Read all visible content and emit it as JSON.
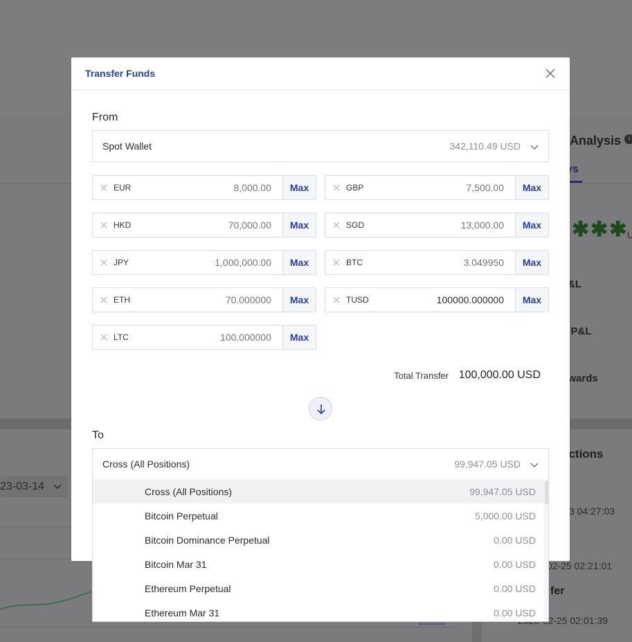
{
  "background": {
    "analysis_title": "Analysis",
    "tab_partial": "ys",
    "masked_value": "✱✱✱",
    "masked_suffix": "U",
    "row1": "&L",
    "row2": "s P&L",
    "row3": "ewards",
    "transactions_title": "actions",
    "date_partial": "23-03-14",
    "tx1_time": "3 04:27:03",
    "tx2_time": "02-25 02:21:01",
    "tx3_label": "fer",
    "tx3_time": "2023-02-25 02:01:39"
  },
  "modal": {
    "title": "Transfer Funds",
    "from_label": "From",
    "from_wallet": {
      "name": "Spot Wallet",
      "balance": "342,110.49 USD"
    },
    "coins": [
      {
        "name": "EUR",
        "value": "",
        "placeholder": "8,000.00",
        "max": "Max"
      },
      {
        "name": "GBP",
        "value": "",
        "placeholder": "7,500.00",
        "max": "Max"
      },
      {
        "name": "HKD",
        "value": "",
        "placeholder": "70,000.00",
        "max": "Max"
      },
      {
        "name": "SGD",
        "value": "",
        "placeholder": "13,000.00",
        "max": "Max"
      },
      {
        "name": "JPY",
        "value": "",
        "placeholder": "1,000,000.00",
        "max": "Max"
      },
      {
        "name": "BTC",
        "value": "",
        "placeholder": "3.049950",
        "max": "Max"
      },
      {
        "name": "ETH",
        "value": "",
        "placeholder": "70.000000",
        "max": "Max"
      },
      {
        "name": "TUSD",
        "value": "100000.000000",
        "placeholder": "",
        "max": "Max"
      },
      {
        "name": "LTC",
        "value": "",
        "placeholder": "100.000000",
        "max": "Max"
      }
    ],
    "total_label": "Total Transfer",
    "total_value": "100,000.00 USD",
    "to_label": "To",
    "to_wallet": {
      "name": "Cross (All Positions)",
      "balance": "99,947.05 USD"
    }
  },
  "dropdown": {
    "items": [
      {
        "name": "Cross (All Positions)",
        "balance": "99,947.05 USD",
        "active": true
      },
      {
        "name": "Bitcoin Perpetual",
        "balance": "5,000.00 USD"
      },
      {
        "name": "Bitcoin Dominance Perpetual",
        "balance": "0.00 USD"
      },
      {
        "name": "Bitcoin Mar 31",
        "balance": "0.00 USD"
      },
      {
        "name": "Ethereum Perpetual",
        "balance": "0.00 USD"
      },
      {
        "name": "Ethereum Mar 31",
        "balance": "0.00 USD"
      }
    ]
  },
  "colors": {
    "accent": "#2a3f9d",
    "overlay": "#7d7d7f",
    "chart_line": "#3f6f52"
  }
}
